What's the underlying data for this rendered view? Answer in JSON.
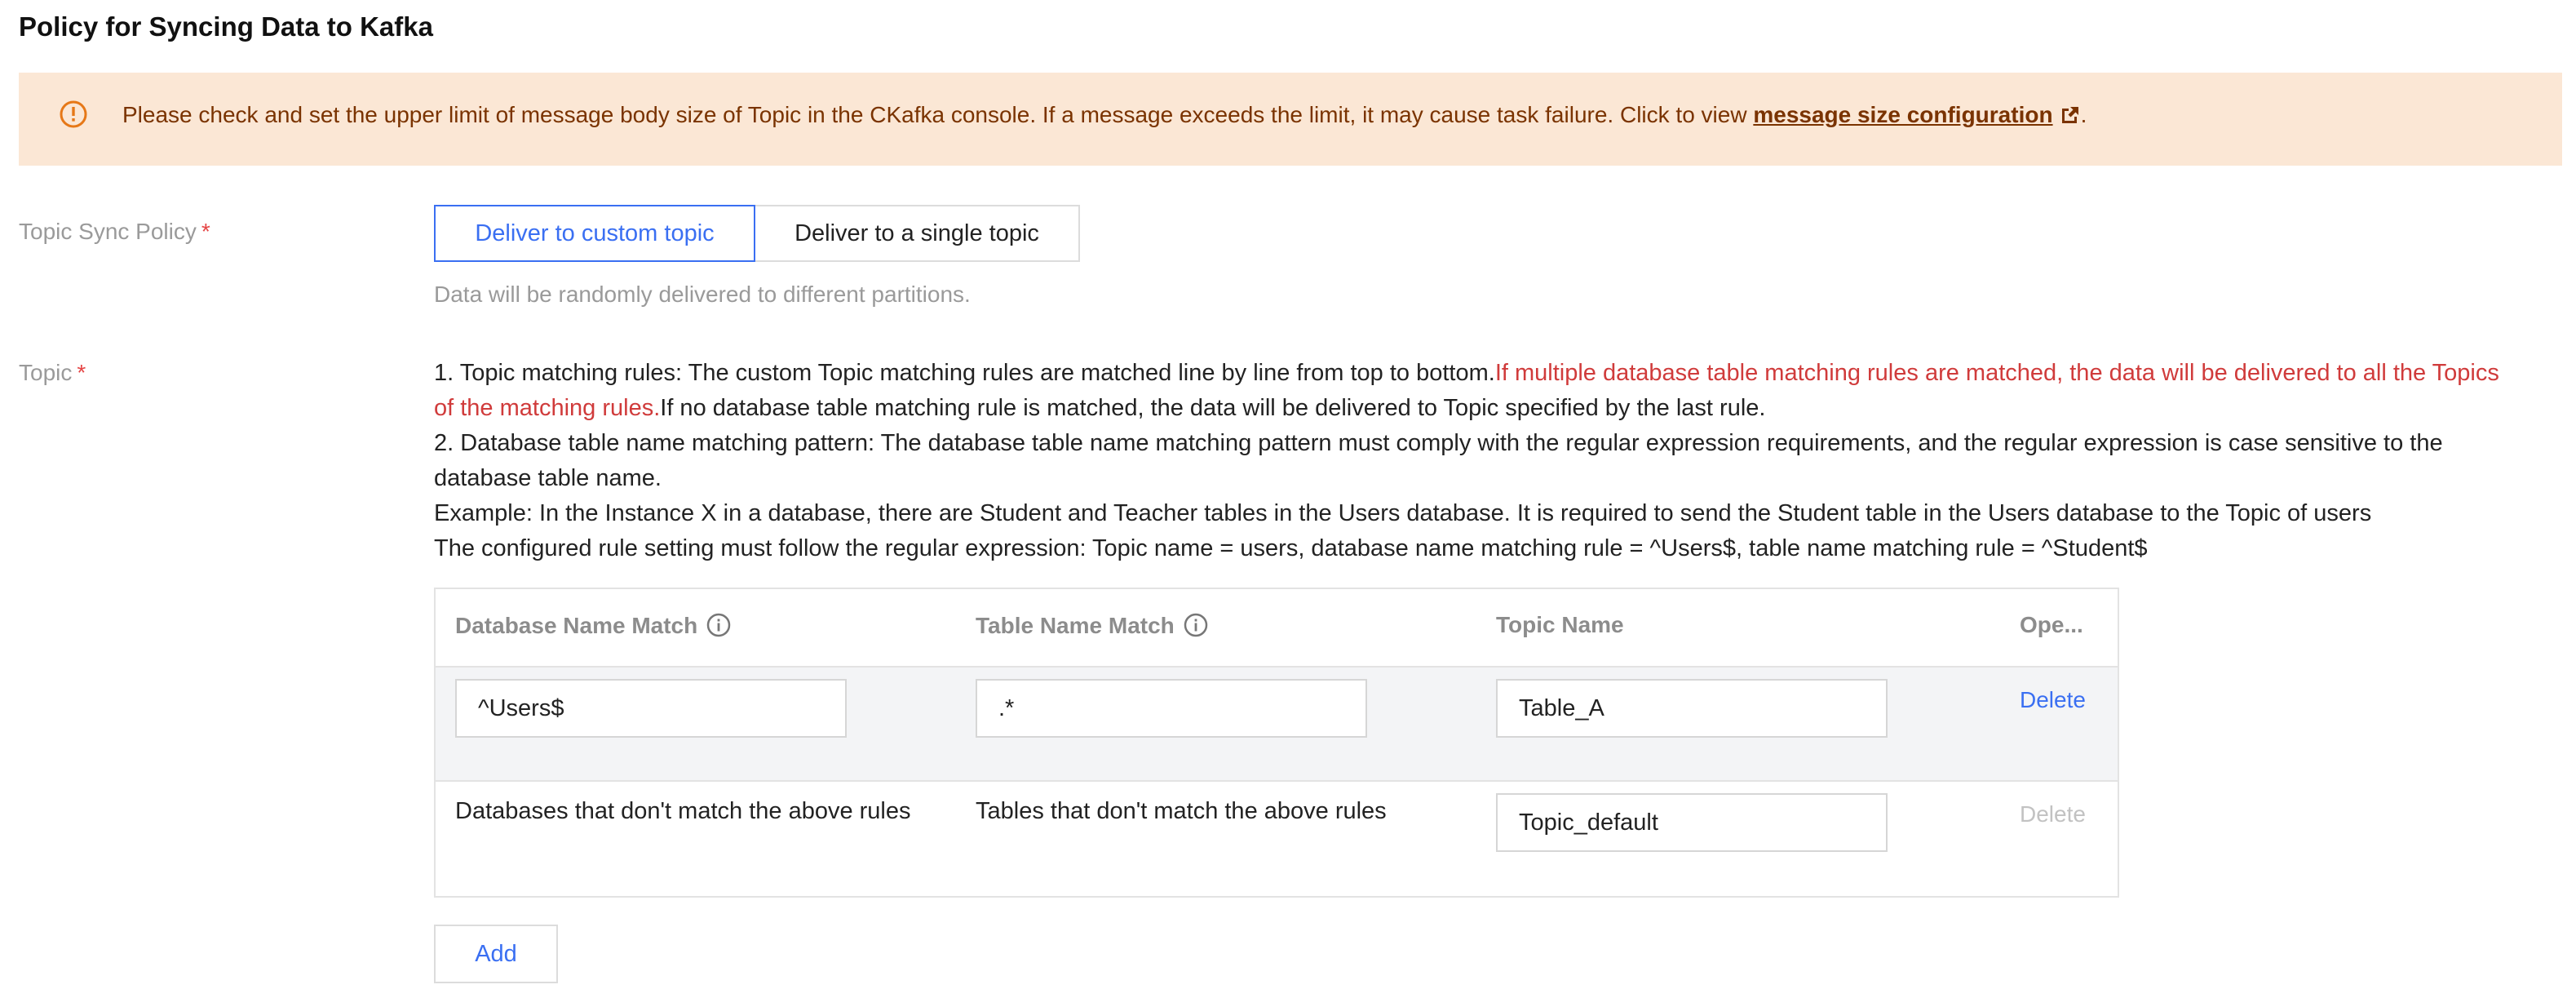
{
  "page": {
    "title": "Policy for Syncing Data to Kafka"
  },
  "alert": {
    "icon": "warning-circle-icon",
    "text": "Please check and set the upper limit of message body size of Topic in the CKafka console. If a message exceeds the limit, it may cause task failure. Click to view",
    "link_label": "message size configuration",
    "link_icon": "external-link-icon",
    "suffix": ".",
    "color": "#7a3300",
    "background": "#fbe7d5"
  },
  "topic_sync_policy": {
    "label": "Topic Sync Policy",
    "required_mark": "*",
    "options": [
      "Deliver to custom topic",
      "Deliver to a single topic"
    ],
    "selected": "Deliver to custom topic",
    "hint": "Data will be randomly delivered to different partitions."
  },
  "topic": {
    "label": "Topic",
    "required_mark": "*",
    "desc": {
      "line1_a": "1. Topic matching rules: The custom Topic matching rules are matched line by line from top to bottom.",
      "line1_red": "If multiple database table matching rules are matched, the data will be delivered to all the Topics of the matching rules.",
      "line1_b": "If no database table matching rule is matched, the data will be delivered to Topic specified by the last rule.",
      "line2": "2. Database table name matching pattern: The database table name matching pattern must comply with the regular expression requirements, and the regular expression is case sensitive to the database table name.",
      "example": "Example: In the Instance X in a database, there are Student and Teacher tables in the Users database. It is required to send the Student table in the Users database to the Topic of users",
      "rule": "The configured rule setting must follow the regular expression: Topic name = users, database name matching rule = ^Users$, table name matching rule = ^Student$"
    }
  },
  "rules_table": {
    "headers": {
      "db": "Database Name Match",
      "table": "Table Name Match",
      "topic": "Topic Name",
      "op": "Ope..."
    },
    "rows": [
      {
        "db": "^Users$",
        "table": ".*",
        "topic": "Table_A",
        "op": "Delete"
      }
    ],
    "default_row": {
      "db": "Databases that don't match the above rules",
      "table": "Tables that don't match the above rules",
      "topic": "Topic_default",
      "op": "Delete"
    },
    "add_label": "Add"
  },
  "colors": {
    "accent": "#3a6ff2",
    "danger": "#d03b3b",
    "required": "#e54545",
    "muted": "#9a9a9a"
  }
}
